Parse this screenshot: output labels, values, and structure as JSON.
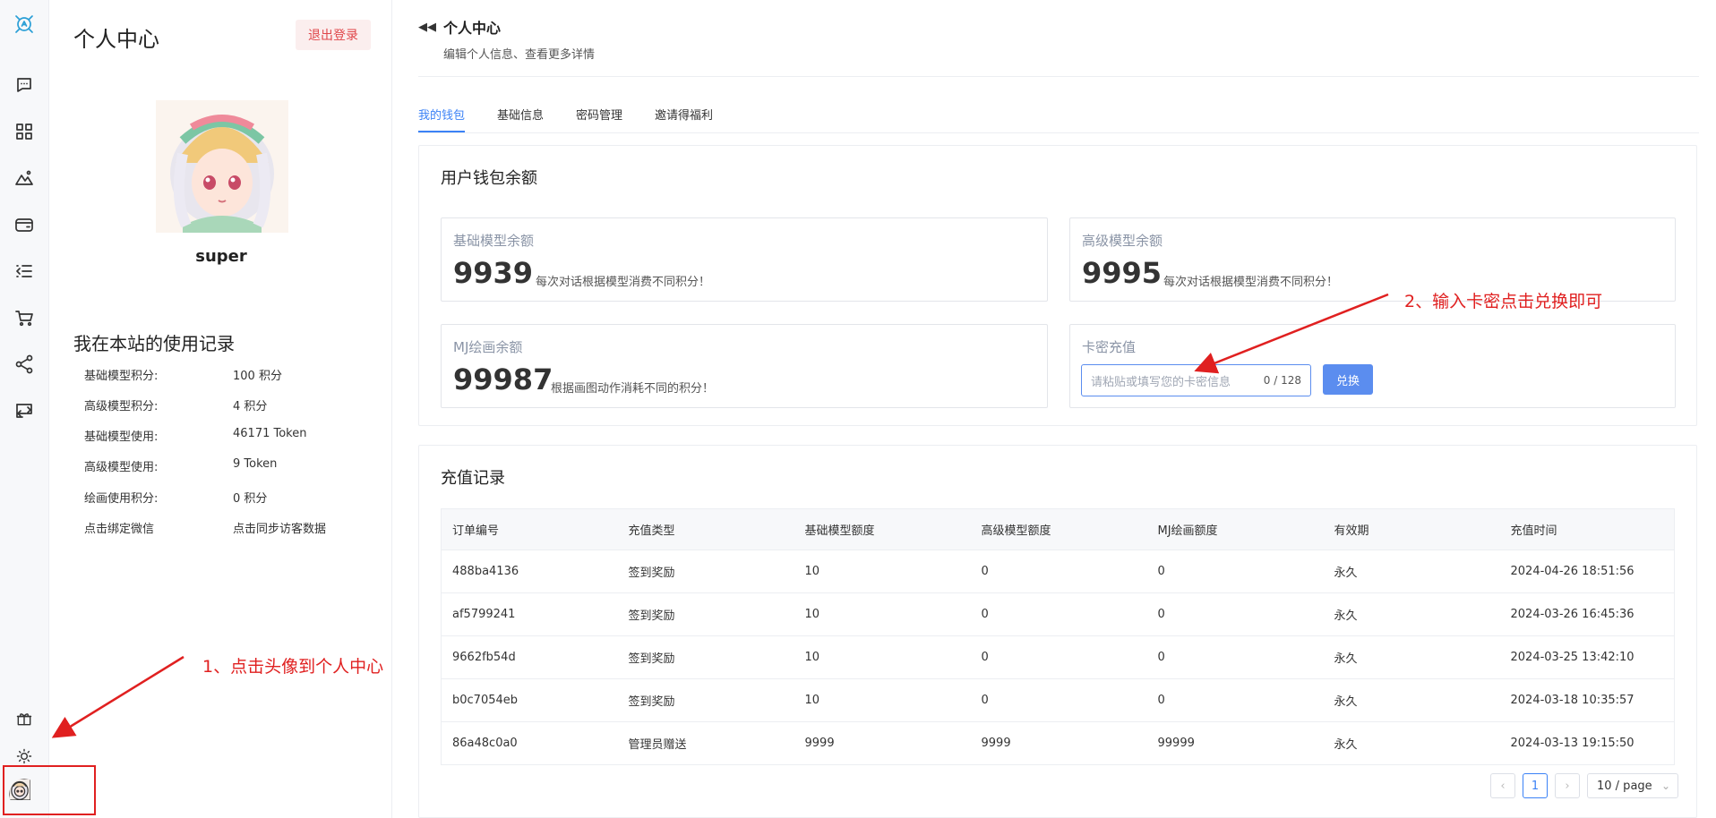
{
  "rail": {
    "icons": [
      "logo-icon",
      "chat-icon",
      "apps-icon",
      "image-icon",
      "wallet-icon",
      "list-icon",
      "cart-icon",
      "share-icon",
      "transfer-icon",
      "gift-icon",
      "sun-icon"
    ]
  },
  "profile": {
    "title": "个人中心",
    "logout_label": "退出登录",
    "username": "super",
    "usage_title": "我在本站的使用记录",
    "usage": [
      {
        "label": "基础模型积分:",
        "value": "100 积分"
      },
      {
        "label": "高级模型积分:",
        "value": "4 积分"
      },
      {
        "label": "基础模型使用:",
        "value": "46171 Token"
      },
      {
        "label": "高级模型使用:",
        "value": "9 Token"
      },
      {
        "label": "绘画使用积分:",
        "value": "0 积分"
      },
      {
        "label": "点击绑定微信",
        "value": "点击同步访客数据"
      }
    ]
  },
  "header": {
    "title": "个人中心",
    "subtitle": "编辑个人信息、查看更多详情"
  },
  "tabs": [
    {
      "label": "我的钱包",
      "active": true
    },
    {
      "label": "基础信息",
      "active": false
    },
    {
      "label": "密码管理",
      "active": false
    },
    {
      "label": "邀请得福利",
      "active": false
    }
  ],
  "wallet": {
    "title": "用户钱包余额",
    "basic": {
      "label": "基础模型余额",
      "value": "9939",
      "desc": "每次对话根据模型消费不同积分！"
    },
    "advanced": {
      "label": "高级模型余额",
      "value": "9995",
      "desc": "每次对话根据模型消费不同积分！"
    },
    "mj": {
      "label": "MJ绘画余额",
      "value": "99987",
      "desc": "根据画图动作消耗不同的积分！"
    },
    "redeem": {
      "label": "卡密充值",
      "placeholder": "请粘贴或填写您的卡密信息",
      "counter": "0 / 128",
      "button": "兑换"
    }
  },
  "records": {
    "title": "充值记录",
    "columns": [
      "订单编号",
      "充值类型",
      "基础模型额度",
      "高级模型额度",
      "MJ绘画额度",
      "有效期",
      "充值时间"
    ],
    "rows": [
      [
        "488ba4136",
        "签到奖励",
        "10",
        "0",
        "0",
        "永久",
        "2024-04-26 18:51:56"
      ],
      [
        "af5799241",
        "签到奖励",
        "10",
        "0",
        "0",
        "永久",
        "2024-03-26 16:45:36"
      ],
      [
        "9662fb54d",
        "签到奖励",
        "10",
        "0",
        "0",
        "永久",
        "2024-03-25 13:42:10"
      ],
      [
        "b0c7054eb",
        "签到奖励",
        "10",
        "0",
        "0",
        "永久",
        "2024-03-18 10:35:57"
      ],
      [
        "86a48c0a0",
        "管理员赠送",
        "9999",
        "9999",
        "99999",
        "永久",
        "2024-03-13 19:15:50"
      ]
    ],
    "pager": {
      "prev": "‹",
      "page": "1",
      "next": "›",
      "size": "10 / page",
      "size_caret": "⌄"
    }
  },
  "annotations": {
    "step1": "1、点击头像到个人中心",
    "step2": "2、输入卡密点击兑换即可",
    "color": "#e02020"
  },
  "colors": {
    "accent": "#3b82f6",
    "button": "#5b8def",
    "logout_bg": "#fbeeee",
    "logout_text": "#e0474b"
  }
}
